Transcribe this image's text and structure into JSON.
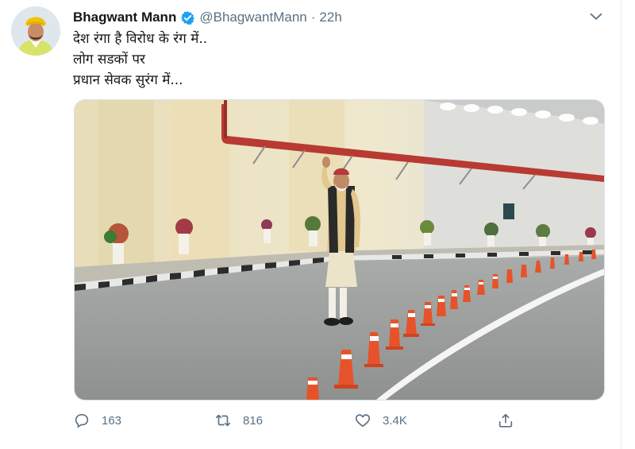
{
  "tweet": {
    "author_name": "Bhagwant Mann",
    "handle": "@BhagwantMann",
    "separator": "·",
    "time": "22h",
    "lines": [
      "देश रंगा है विरोध के रंग में..",
      "लोग सडकों पर",
      "प्रधान सेवक सुरंग में..."
    ],
    "media_description": "man waving in a tunnel with traffic cones"
  },
  "actions": {
    "reply_count": "163",
    "retweet_count": "816",
    "like_count": "3.4K"
  },
  "icons": {
    "verified": "verified-badge-icon",
    "caret": "chevron-down-icon",
    "reply": "reply-icon",
    "retweet": "retweet-icon",
    "like": "heart-icon",
    "share": "share-icon"
  },
  "colors": {
    "verified": "#1da1f2",
    "secondary_text": "#5b7083",
    "primary_text": "#14171a",
    "turban": "#f2c200"
  }
}
